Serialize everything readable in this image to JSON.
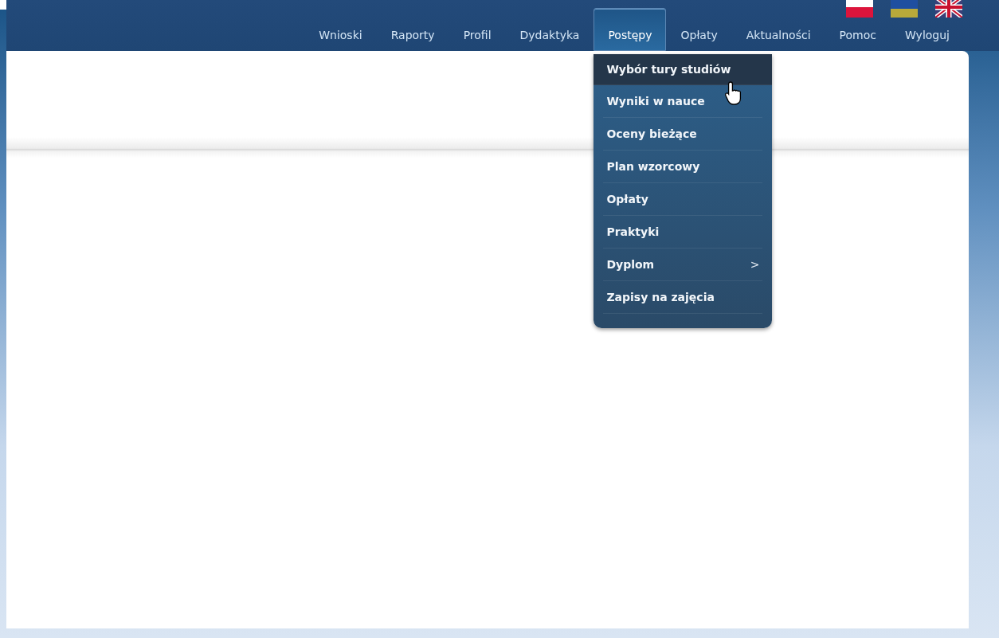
{
  "flags": [
    {
      "kind": "pl"
    },
    {
      "kind": "ua"
    },
    {
      "kind": "uk"
    }
  ],
  "nav": [
    {
      "label": "Wnioski",
      "selected": false
    },
    {
      "label": "Raporty",
      "selected": false
    },
    {
      "label": "Profil",
      "selected": false
    },
    {
      "label": "Dydaktyka",
      "selected": false
    },
    {
      "label": "Postępy",
      "selected": true,
      "menu": [
        {
          "label": "Wybór tury studiów",
          "selected": true
        },
        {
          "label": "Wyniki w nauce",
          "selected": false
        },
        {
          "label": "Oceny bieżące",
          "selected": false
        },
        {
          "label": "Plan wzorcowy",
          "selected": false
        },
        {
          "label": "Opłaty",
          "selected": false
        },
        {
          "label": "Praktyki",
          "selected": false
        },
        {
          "label": "Dyplom",
          "selected": false,
          "submenu_arrow": ">"
        },
        {
          "label": "Zapisy na zajęcia",
          "selected": false
        }
      ]
    },
    {
      "label": "Opłaty",
      "selected": false
    },
    {
      "label": "Aktualności",
      "selected": false
    },
    {
      "label": "Pomoc",
      "selected": false
    },
    {
      "label": "Wyloguj",
      "selected": false
    }
  ]
}
